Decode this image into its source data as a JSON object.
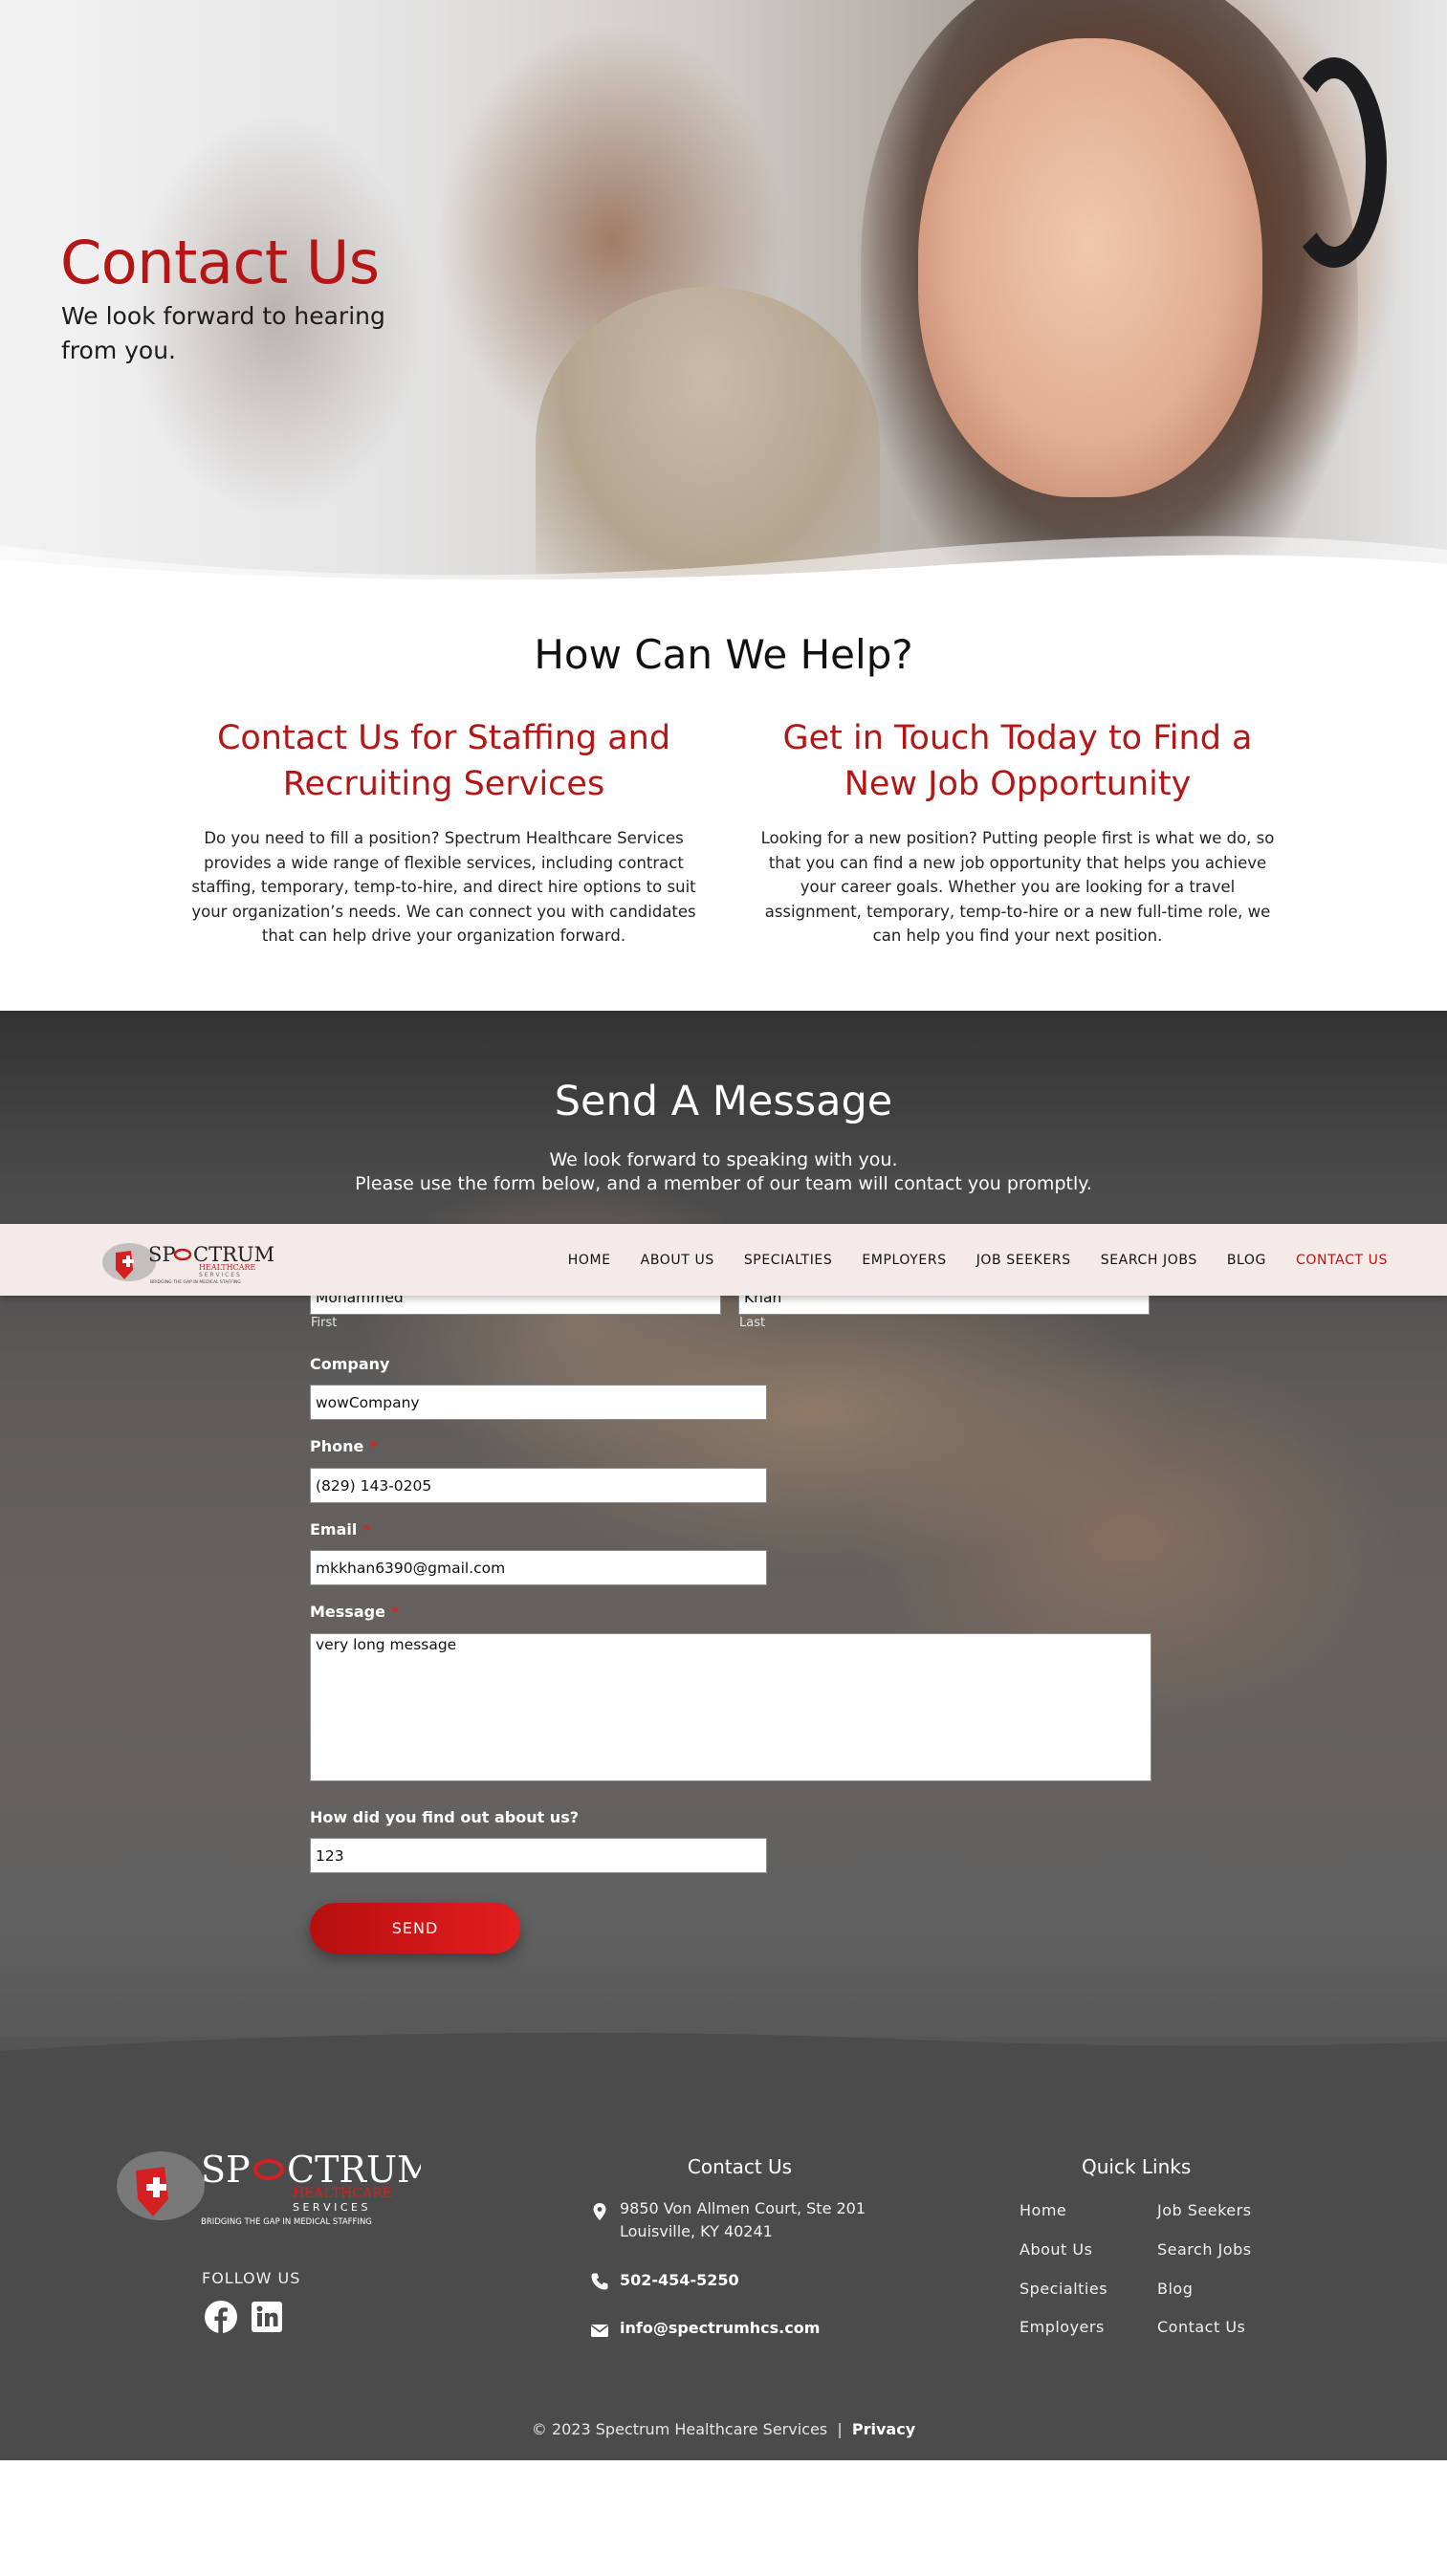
{
  "hero": {
    "title": "Contact Us",
    "subtitle": "We look forward to hearing from you."
  },
  "help": {
    "title": "How Can We Help?",
    "left": {
      "heading": "Contact Us for Staffing and Recruiting Services",
      "body": "Do you need to fill a position?  Spectrum Healthcare Services provides a wide range of flexible services, including contract staffing, temporary, temp-to-hire, and direct hire options to suit your organization’s needs.  We can connect you with candidates that can help drive your organization forward."
    },
    "right": {
      "heading": "Get in Touch Today to Find a New Job Opportunity",
      "body": "Looking for a new position?  Putting people first is what we do, so that you can find a new job opportunity that helps you achieve your career goals.  Whether you are looking for a travel assignment, temporary, temp-to-hire or a new full-time role, we can help you find your next position."
    }
  },
  "message": {
    "title": "Send A Message",
    "sub_line1": "We look forward to speaking with you.",
    "sub_line2": "Please use the form below, and a member of our team will contact you promptly."
  },
  "form": {
    "first_value": "Mohammed",
    "first_sublabel": "First",
    "last_value": "Khan",
    "last_sublabel": "Last",
    "company_label": "Company",
    "company_value": "wowCompany",
    "phone_label": "Phone",
    "phone_value": "(829) 143-0205",
    "email_label": "Email",
    "email_value": "mkkhan6390@gmail.com",
    "message_label": "Message",
    "message_value": "very long message",
    "source_label": "How did you find out about us?",
    "source_value": "123",
    "required_mark": "*",
    "send_label": "SEND"
  },
  "nav": {
    "logo_alt": "SPECTRUM HEALTHCARE SERVICES",
    "items": [
      "HOME",
      "ABOUT US",
      "SPECIALTIES",
      "EMPLOYERS",
      "JOB SEEKERS",
      "SEARCH JOBS",
      "BLOG",
      "CONTACT US"
    ],
    "active": "CONTACT US"
  },
  "logo": {
    "word_a": "SP",
    "word_b": "CTRUM",
    "line2": "HEALTHCARE",
    "line3": "S E R V I C E S",
    "tagline": "BRIDGING THE GAP IN MEDICAL STAFFING"
  },
  "footer": {
    "follow": "FOLLOW US",
    "contact_title": "Contact Us",
    "address_line1": "9850 Von Allmen Court, Ste 201",
    "address_line2": "Louisville, KY 40241",
    "phone": "502-454-5250",
    "email": "info@spectrumhcs.com",
    "quicklinks_title": "Quick Links",
    "links_col1": [
      "Home",
      "About Us",
      "Specialties",
      "Employers"
    ],
    "links_col2": [
      "Job Seekers",
      "Search Jobs",
      "Blog",
      "Contact Us"
    ],
    "copyright": "© 2023 Spectrum Healthcare Services",
    "separator": "|",
    "privacy": "Privacy"
  },
  "colors": {
    "brand_red": "#b51515",
    "footer_bg": "#4b4b4b",
    "nav_bg": "#f4ebe9"
  },
  "icons": [
    "location-pin-icon",
    "phone-icon",
    "envelope-icon",
    "facebook-icon",
    "linkedin-icon"
  ]
}
